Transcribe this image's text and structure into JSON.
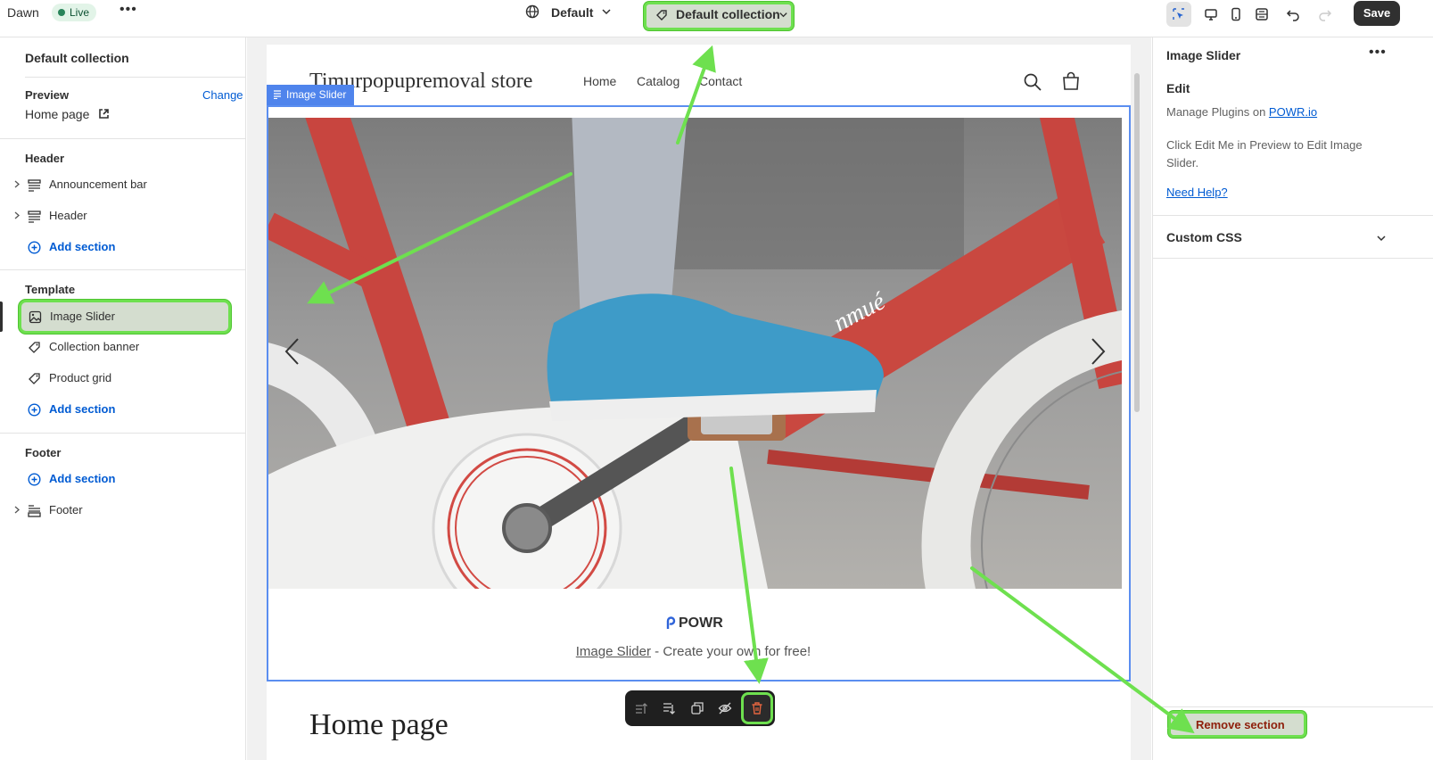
{
  "topbar": {
    "theme_name": "Dawn",
    "live_badge": "Live",
    "more": "•••",
    "template_label": "Default",
    "collection_label": "Default collection",
    "save_label": "Save"
  },
  "sidebar": {
    "title": "Default collection",
    "preview_label": "Preview",
    "change_label": "Change",
    "preview_page": "Home page",
    "header_group": "Header",
    "header_items": [
      {
        "label": "Announcement bar"
      },
      {
        "label": "Header"
      }
    ],
    "add_section": "Add section",
    "template_group": "Template",
    "template_items": [
      {
        "label": "Image Slider"
      },
      {
        "label": "Collection banner"
      },
      {
        "label": "Product grid"
      }
    ],
    "footer_group": "Footer",
    "footer_items": [
      {
        "label": "Footer"
      }
    ]
  },
  "preview": {
    "store_name": "Timurpopupremoval store",
    "nav": [
      "Home",
      "Catalog",
      "Contact"
    ],
    "section_tag": "Image Slider",
    "powr_brand": "POWR",
    "credit_link": "Image Slider",
    "credit_text": " - Create your own for free!",
    "page_heading": "Home page"
  },
  "rightpanel": {
    "title": "Image Slider",
    "more": "•••",
    "edit_heading": "Edit",
    "manage_prefix": "Manage Plugins on ",
    "manage_link": "POWR.io",
    "click_text": "Click Edit Me in Preview to Edit Image Slider.",
    "need_help": "Need Help?",
    "custom_css": "Custom CSS",
    "remove_section": "Remove section"
  },
  "colors": {
    "highlight_green": "#6ee04f",
    "selection_blue": "#4f84ec",
    "link_blue": "#005bd3",
    "danger": "#8e1f0b"
  }
}
